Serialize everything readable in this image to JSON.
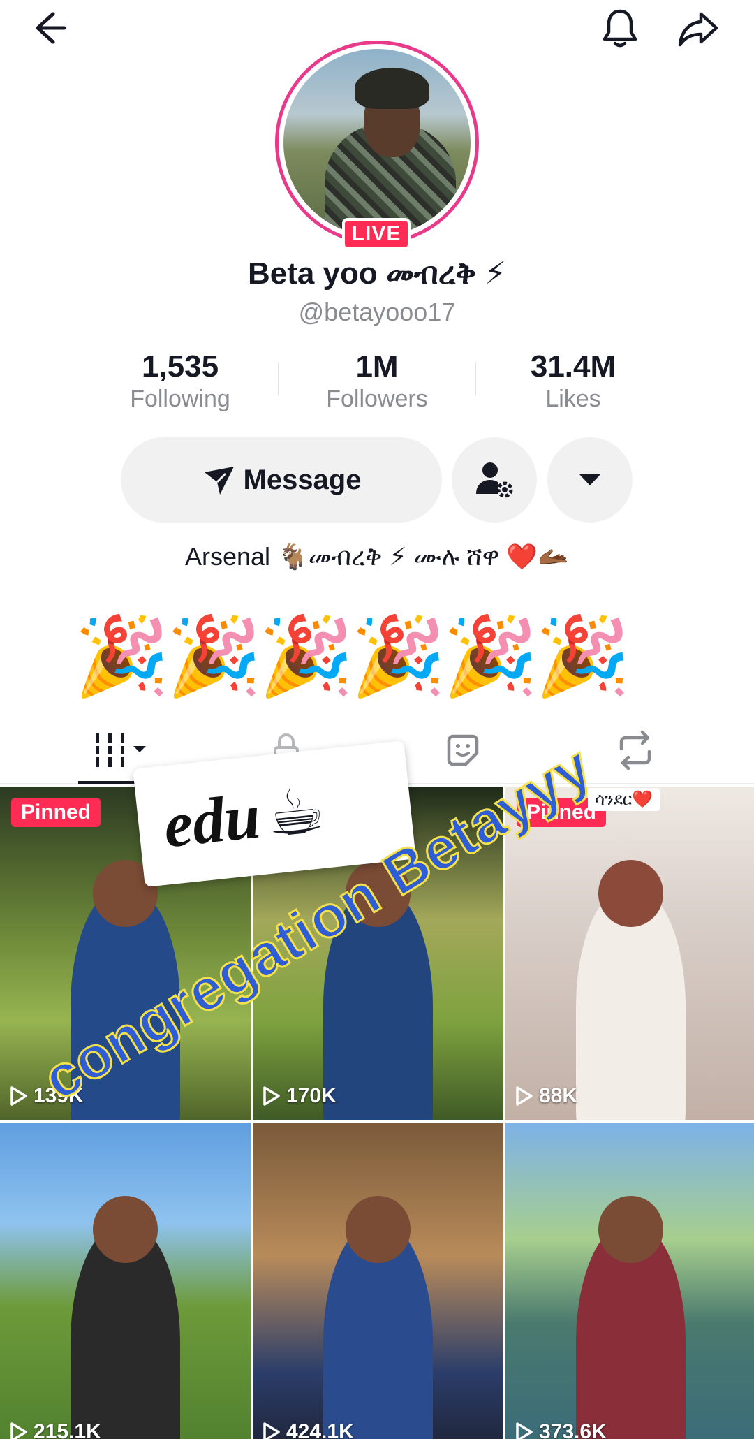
{
  "profile": {
    "name": "Beta yoo መብረቅ ⚡",
    "handle": "@betayooo17",
    "live_label": "LIVE"
  },
  "stats": [
    {
      "value": "1,535",
      "label": "Following"
    },
    {
      "value": "1M",
      "label": "Followers"
    },
    {
      "value": "31.4M",
      "label": "Likes"
    }
  ],
  "actions": {
    "message_label": "Message"
  },
  "bio": "Arsenal 🐐መብረቅ ⚡ ሙሉ ሸዋ ❤️🫴🏾",
  "celebration_emoji": [
    "🎉",
    "🎉",
    "🎉",
    "🎉",
    "🎉",
    "🎉"
  ],
  "icons": {
    "back": "arrow-left-icon",
    "bell": "bell-icon",
    "share": "share-arrow-icon",
    "add_user": "user-settings-icon",
    "more": "caret-down-icon",
    "tab_videos": "grid-icon",
    "tab_private": "private-icon",
    "tab_liked": "sticker-icon",
    "tab_reposts": "repost-icon"
  },
  "grid": [
    {
      "pinned": "Pinned",
      "views": "139K"
    },
    {
      "pinned": "",
      "views": "170K"
    },
    {
      "pinned": "Pinned",
      "views": "88K"
    },
    {
      "pinned": "",
      "views": "215.1K"
    },
    {
      "pinned": "",
      "views": "424.1K"
    },
    {
      "pinned": "",
      "views": "373.6K"
    }
  ],
  "overlays": {
    "sticker_text": "edu",
    "sticker_emoji": "☕",
    "banner_text": "congregation Betayyy",
    "video_tag": "ሳንደር❤️"
  },
  "colors": {
    "accent_red": "#fe2c55",
    "ring_pink": "#e8398a",
    "button_gray": "#f1f1f2",
    "banner_blue": "#2f5dd4",
    "banner_outline": "#f3e04a"
  }
}
